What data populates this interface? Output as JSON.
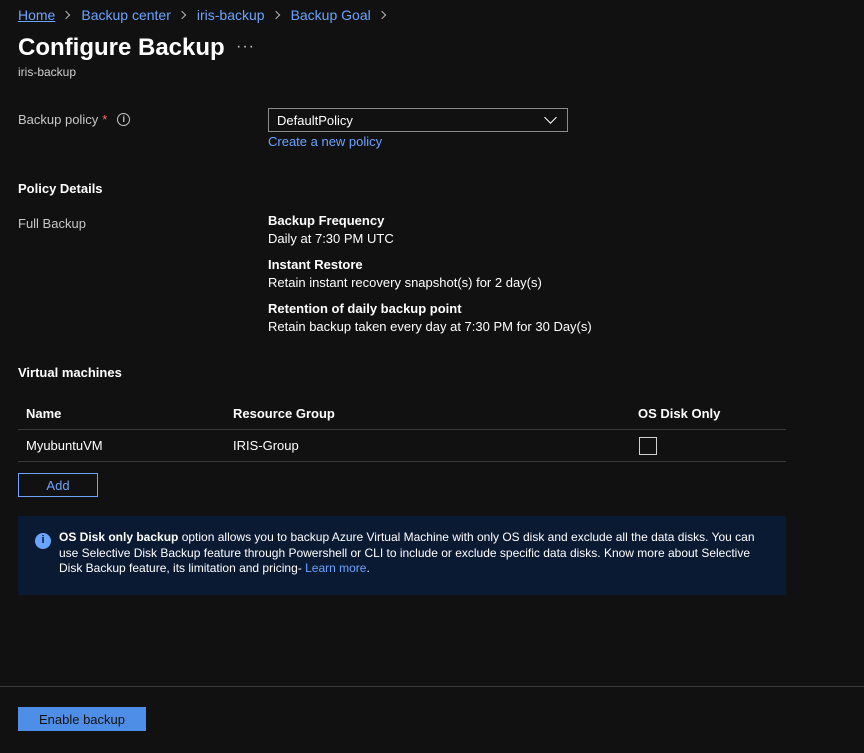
{
  "breadcrumb": [
    "Home",
    "Backup center",
    "iris-backup",
    "Backup Goal"
  ],
  "page": {
    "title": "Configure Backup",
    "more": "···",
    "subtitle": "iris-backup"
  },
  "policy": {
    "label": "Backup policy",
    "required_mark": "*",
    "info": "i",
    "selected": "DefaultPolicy",
    "create_link": "Create a new policy"
  },
  "policy_details": {
    "heading": "Policy Details",
    "type_label": "Full Backup",
    "items": [
      {
        "title": "Backup Frequency",
        "value": "Daily at 7:30 PM UTC"
      },
      {
        "title": "Instant Restore",
        "value": "Retain instant recovery snapshot(s) for 2 day(s)"
      },
      {
        "title": "Retention of daily backup point",
        "value": "Retain backup taken every day at 7:30 PM for 30 Day(s)"
      }
    ]
  },
  "vms": {
    "heading": "Virtual machines",
    "columns": [
      "Name",
      "Resource Group",
      "OS Disk Only"
    ],
    "rows": [
      {
        "name": "MyubuntuVM",
        "group": "IRIS-Group"
      }
    ],
    "add_label": "Add"
  },
  "banner": {
    "icon": "i",
    "bold": "OS Disk only backup",
    "text": " option allows you to backup Azure Virtual Machine with only OS disk and exclude all the data disks. You can use Selective Disk Backup feature through Powershell or CLI to include or exclude specific data disks. Know more about Selective Disk Backup feature, its limitation and pricing- ",
    "link": "Learn more",
    "end": "."
  },
  "footer": {
    "enable_label": "Enable backup"
  }
}
